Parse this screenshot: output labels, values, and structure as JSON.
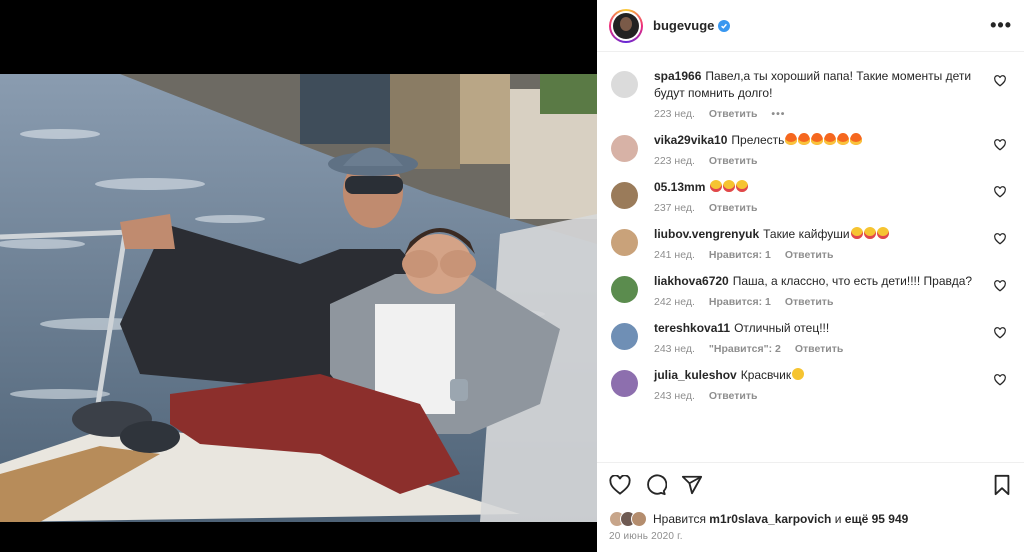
{
  "post": {
    "username": "bugevuge",
    "verified": true,
    "more_label": "•••",
    "date": "20 июнь 2020 г."
  },
  "comments": [
    {
      "username": "spa1966",
      "text": "Павел,а ты хороший папа! Такие моменты дети будут помнить долго!",
      "time": "223 нед.",
      "reply": "Ответить",
      "likes": "",
      "extra": "•••",
      "avatar_color": "#dbdbdb",
      "emoji": []
    },
    {
      "username": "vika29vika10",
      "text": "Прелесть",
      "time": "223 нед.",
      "reply": "Ответить",
      "likes": "",
      "extra": "",
      "avatar_color": "#d7b2a6",
      "emoji": [
        "fire",
        "fire",
        "fire",
        "fire",
        "fire",
        "fire"
      ]
    },
    {
      "username": "05.13mm",
      "text": "",
      "time": "237 нед.",
      "reply": "Ответить",
      "likes": "",
      "extra": "",
      "avatar_color": "#9a7b5a",
      "emoji": [
        "heart-eyes",
        "heart-eyes",
        "heart-eyes"
      ]
    },
    {
      "username": "liubov.vengrenyuk",
      "text": "Такие кайфуши",
      "time": "241 нед.",
      "reply": "Ответить",
      "likes": "Нравится: 1",
      "extra": "",
      "avatar_color": "#c9a27a",
      "emoji": [
        "heart-eyes",
        "heart-eyes",
        "heart-eyes"
      ]
    },
    {
      "username": "liakhova6720",
      "text": "Паша, а классно, что есть дети!!!! Правда?",
      "time": "242 нед.",
      "reply": "Ответить",
      "likes": "Нравится: 1",
      "extra": "",
      "avatar_color": "#5b8c4e",
      "emoji": []
    },
    {
      "username": "tereshkova11",
      "text": "Отличный отец!!!",
      "time": "243 нед.",
      "reply": "Ответить",
      "likes": "\"Нравится\": 2",
      "extra": "",
      "avatar_color": "#6f8fb5",
      "emoji": []
    },
    {
      "username": "julia_kuleshov",
      "text": "Красвчик",
      "time": "243 нед.",
      "reply": "Ответить",
      "likes": "",
      "extra": "",
      "avatar_color": "#8d6fae",
      "emoji": [
        "wink-kiss"
      ]
    }
  ],
  "likes": {
    "prefix": "Нравится",
    "user": "m1r0slava_karpovich",
    "conj": "и",
    "count": "ещё 95 949"
  },
  "icons": {
    "like": "heart-outline-icon",
    "comment": "comment-bubble-icon",
    "share": "paper-plane-icon",
    "save": "bookmark-icon",
    "verified": "verified-badge-icon"
  },
  "colors": {
    "accent_verified": "#3897f0",
    "secondary_text": "#8e8e8e",
    "primary_text": "#262626"
  }
}
